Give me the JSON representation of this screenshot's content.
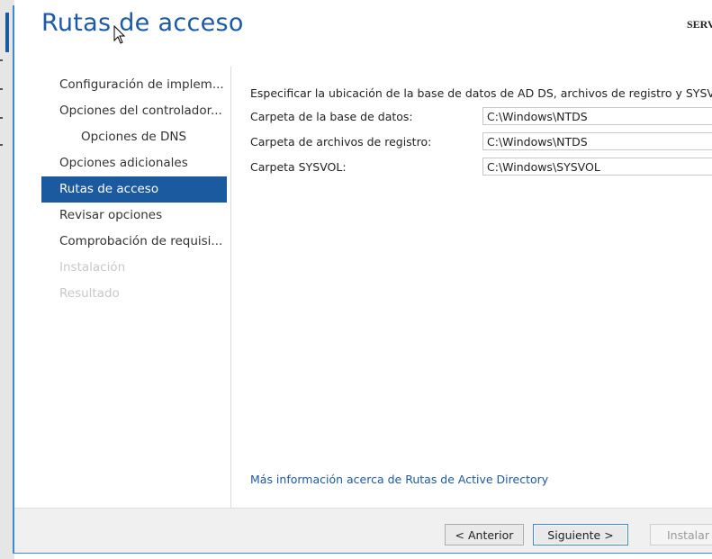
{
  "window": {
    "title": "Rutas de acceso",
    "server": "SERV"
  },
  "nav": {
    "items": [
      {
        "label": "Configuración de implem..."
      },
      {
        "label": "Opciones del controlador..."
      },
      {
        "label": "Opciones de DNS"
      },
      {
        "label": "Opciones adicionales"
      },
      {
        "label": "Rutas de acceso"
      },
      {
        "label": "Revisar opciones"
      },
      {
        "label": "Comprobación de requisi..."
      },
      {
        "label": "Instalación"
      },
      {
        "label": "Resultado"
      }
    ]
  },
  "main": {
    "intro": "Especificar la ubicación de la base de datos de AD DS, archivos de registro y SYSVOL",
    "fields": [
      {
        "label": "Carpeta de la base de datos:",
        "value": "C:\\Windows\\NTDS"
      },
      {
        "label": "Carpeta de archivos de registro:",
        "value": "C:\\Windows\\NTDS"
      },
      {
        "label": "Carpeta SYSVOL:",
        "value": "C:\\Windows\\SYSVOL"
      }
    ],
    "more_link": "Más información acerca de Rutas de Active Directory"
  },
  "footer": {
    "prev": "< Anterior",
    "next": "Siguiente >",
    "install": "Instalar"
  },
  "colors": {
    "accent": "#1c5aa0",
    "title": "#1a5aa8",
    "frame_border": "#3a8ad6",
    "disabled_text": "#c8c8c8"
  }
}
